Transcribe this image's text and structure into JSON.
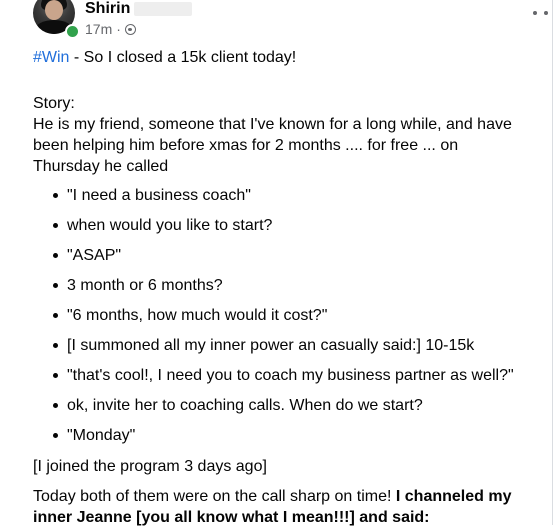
{
  "post": {
    "author": "Shirin",
    "time": "17m",
    "separator": "·",
    "audience_icon": "globe-icon",
    "more_icon": "more-options-icon",
    "headline_tag": "#Win",
    "headline_rest": " - So I closed a 15k client today!",
    "story_label": "Story:",
    "paragraph": "He is my friend, someone that I've known for a long while, and have been helping him before xmas for 2 months .... for free ... on Thursday he called",
    "bullets": [
      "\"I need a business coach\"",
      "when would you like to start?",
      "\"ASAP\"",
      "3 month or 6 months?",
      "\"6 months, how much would it cost?\"",
      "[I summoned all my inner power an casually said:] 10-15k",
      "\"that's cool!, I need you to coach my business partner as well?\"",
      "ok, invite her to coaching calls. When do we start?",
      "\"Monday\""
    ],
    "joined_note": "[I joined the program 3 days ago]",
    "closing_plain": "Today both of them were on the call sharp on time! ",
    "closing_bold": "I channeled my inner Jeanne [you all know what I mean!!!] and said:"
  }
}
